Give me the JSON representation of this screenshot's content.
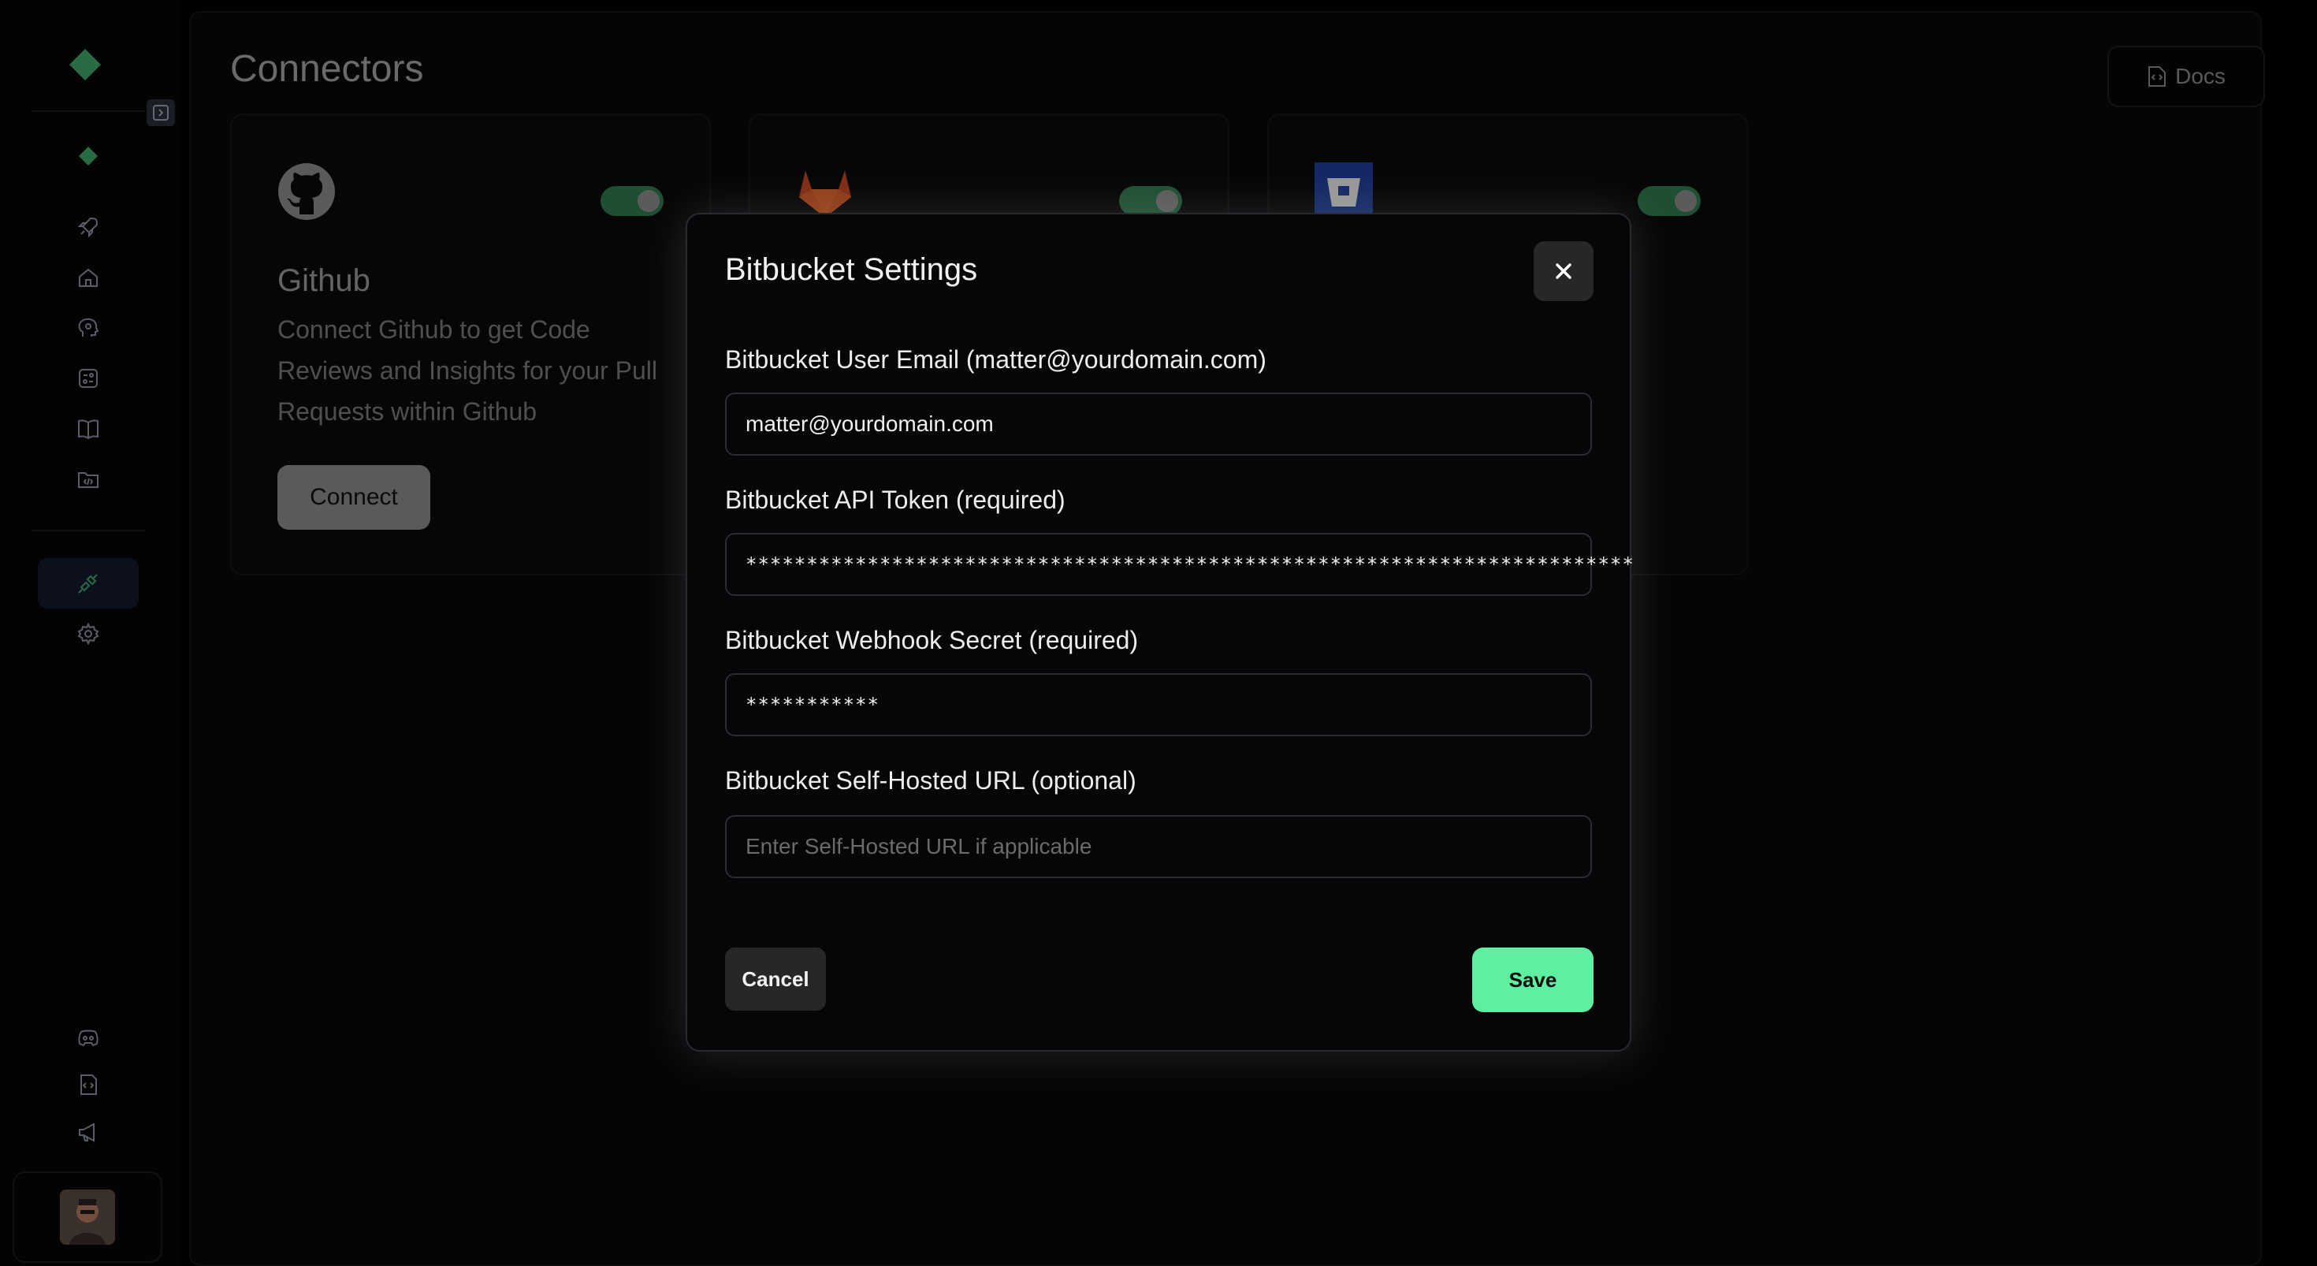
{
  "page": {
    "title": "Connectors",
    "docs_label": "Docs"
  },
  "sidebar": {
    "items": [
      {
        "icon": "rocket-icon"
      },
      {
        "icon": "home-icon"
      },
      {
        "icon": "brain-icon"
      },
      {
        "icon": "review-icon"
      },
      {
        "icon": "book-icon"
      },
      {
        "icon": "code-folder-icon"
      },
      {
        "icon": "plug-icon",
        "active": true
      },
      {
        "icon": "gear-icon"
      }
    ],
    "bottom_items": [
      {
        "icon": "discord-icon"
      },
      {
        "icon": "docs-icon"
      },
      {
        "icon": "megaphone-icon"
      }
    ]
  },
  "cards": [
    {
      "name": "Github",
      "description": "Connect Github to get Code Reviews and Insights for your Pull Requests within Github",
      "button_label": "Connect",
      "enabled": true
    },
    {
      "name": "GitLab",
      "enabled": true
    },
    {
      "name": "Bitbucket",
      "enabled": true
    }
  ],
  "modal": {
    "title": "Bitbucket Settings",
    "fields": [
      {
        "label": "Bitbucket User Email (matter@yourdomain.com)",
        "value": "matter@yourdomain.com"
      },
      {
        "label": "Bitbucket API Token (required)",
        "value": "*************************************************************************"
      },
      {
        "label": "Bitbucket Webhook Secret (required)",
        "value": "***********"
      },
      {
        "label": "Bitbucket Self-Hosted URL (optional)",
        "value": "",
        "placeholder": "Enter Self-Hosted URL if applicable"
      }
    ],
    "cancel_label": "Cancel",
    "save_label": "Save"
  },
  "colors": {
    "accent": "#5ef0a0",
    "toggle_on": "#2f7a4f",
    "background": "#09090b"
  }
}
